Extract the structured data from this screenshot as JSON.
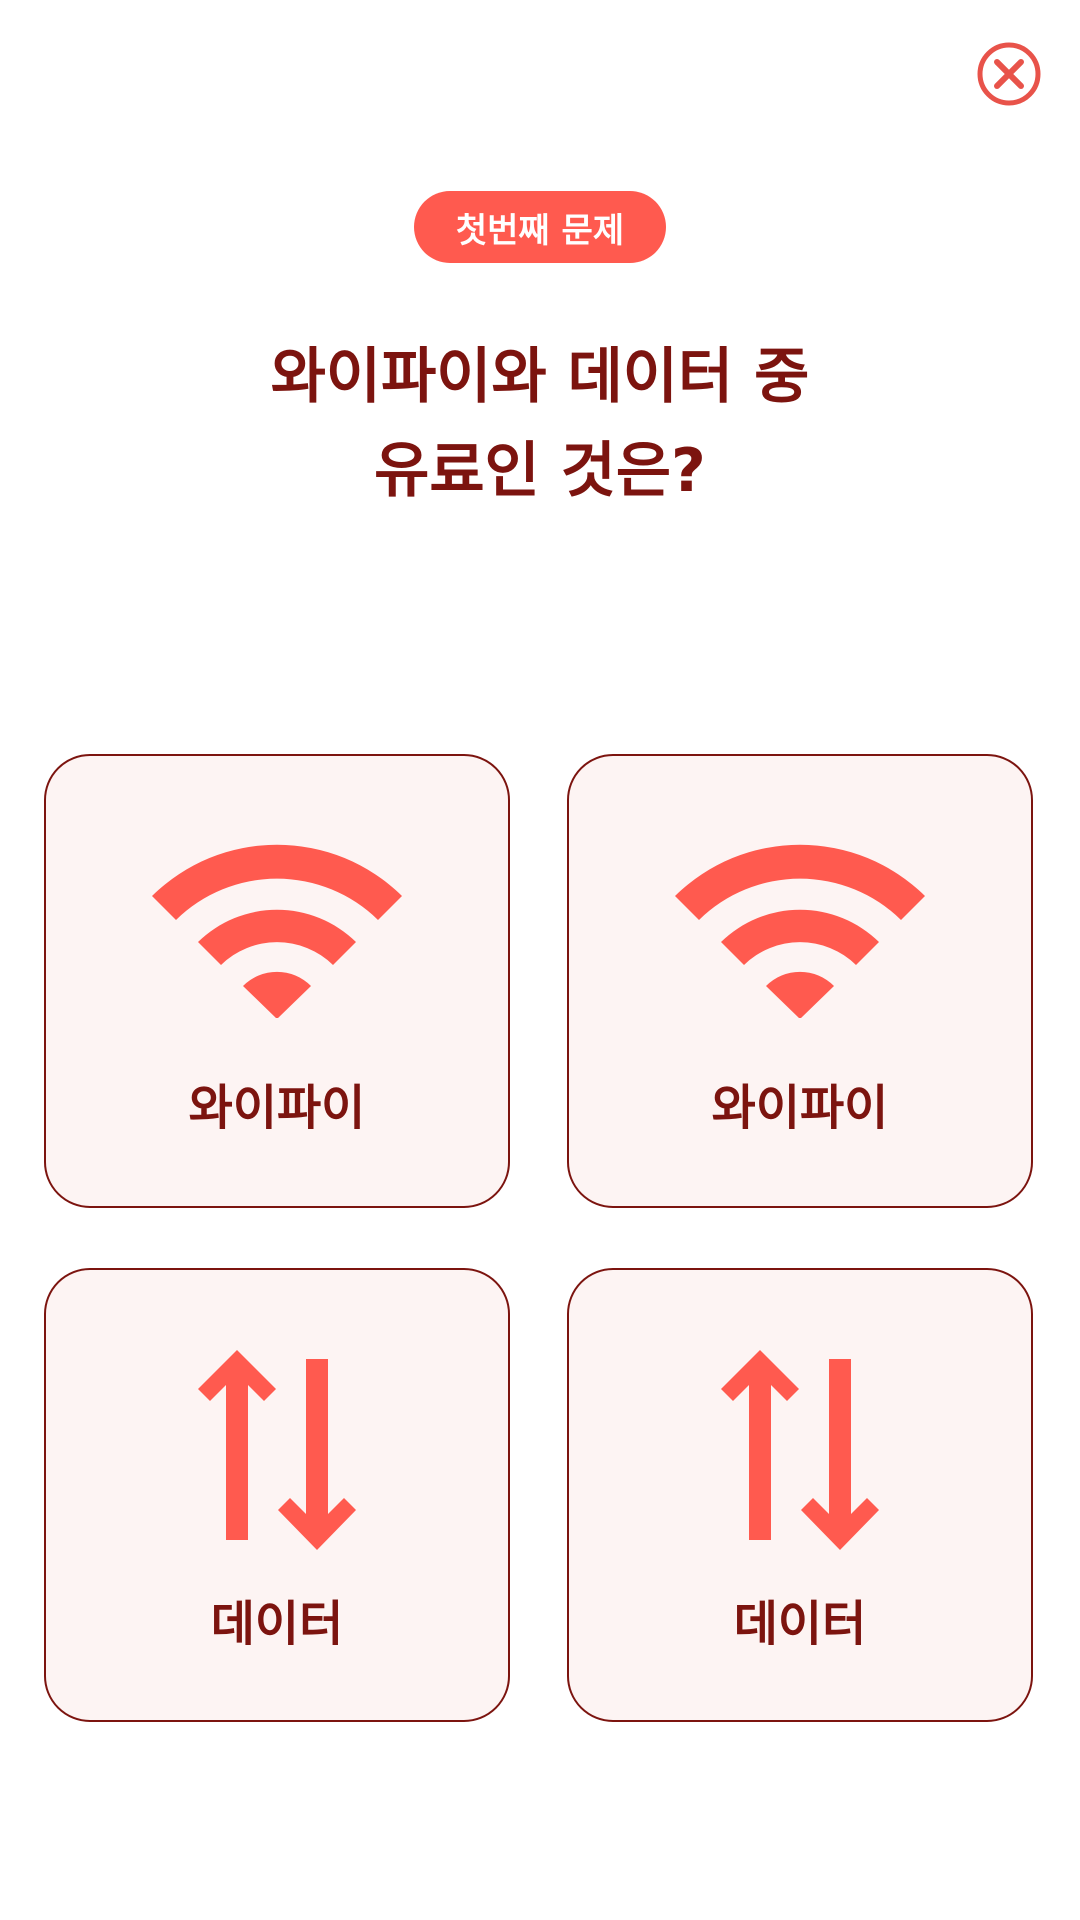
{
  "header": {
    "close_icon": "close-circle-icon"
  },
  "badge": {
    "label": "첫번째 문제"
  },
  "question": {
    "line1": "와이파이와 데이터 중",
    "line2": "유료인 것은?"
  },
  "options": [
    {
      "label": "와이파이",
      "icon": "wifi-icon"
    },
    {
      "label": "와이파이",
      "icon": "wifi-icon"
    },
    {
      "label": "데이터",
      "icon": "data-transfer-icon"
    },
    {
      "label": "데이터",
      "icon": "data-transfer-icon"
    }
  ],
  "colors": {
    "accent": "#ff5a4f",
    "text": "#7c140f",
    "card_bg": "#fdf4f3",
    "card_border": "#7c140f",
    "background": "#ffffff"
  }
}
